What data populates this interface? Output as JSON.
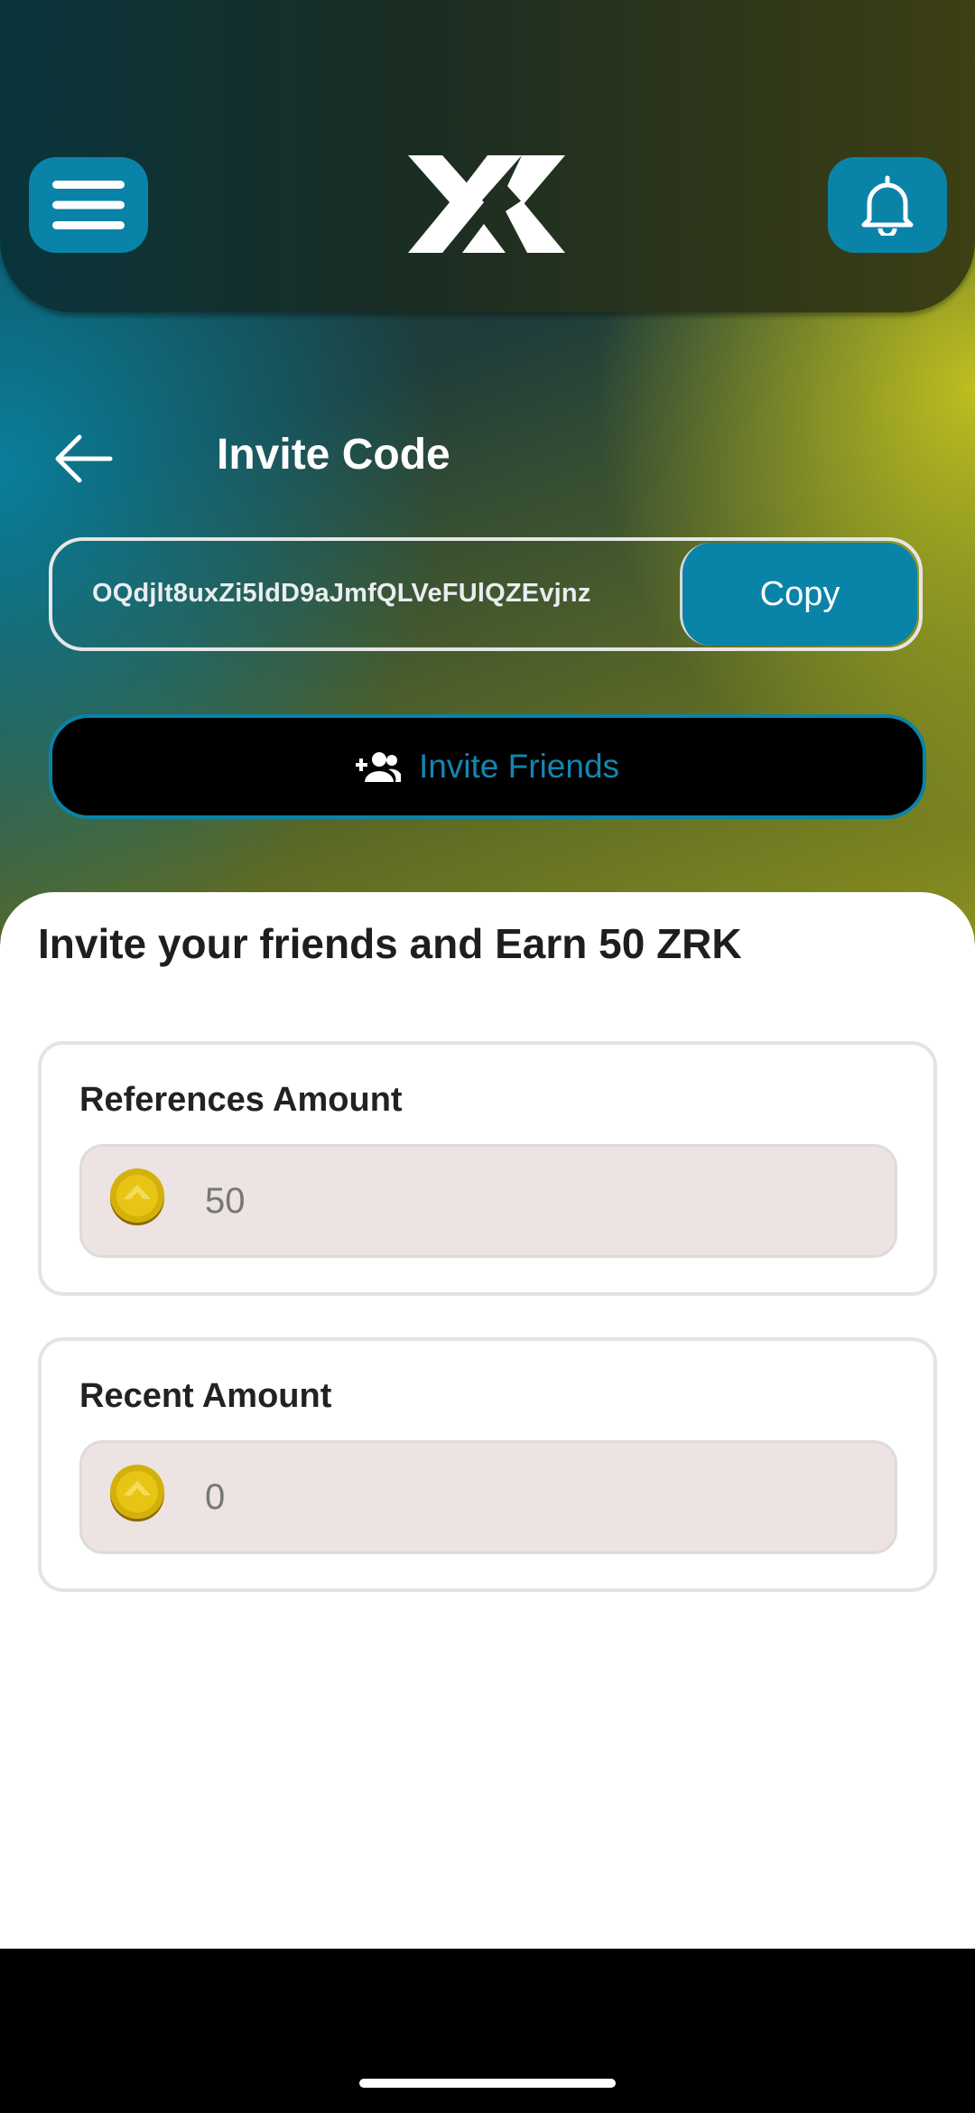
{
  "header": {
    "menu_icon": "hamburger-menu-icon",
    "logo_icon": "zk-logo",
    "bell_icon": "bell-icon"
  },
  "invite": {
    "title": "Invite Code",
    "back_icon": "arrow-left-icon",
    "code": "OQdjlt8uxZi5ldD9aJmfQLVeFUlQZEvjnz",
    "copy_label": "Copy",
    "invite_button_label": "Invite Friends",
    "invite_icon": "person-add-icon"
  },
  "rewards": {
    "headline": "Invite your friends and Earn 50 ZRK",
    "references": {
      "label": "References Amount",
      "value": "50",
      "icon": "coin-icon"
    },
    "recent": {
      "label": "Recent Amount",
      "value": "0",
      "icon": "coin-icon"
    }
  },
  "colors": {
    "accent": "#0a83a8",
    "field_bg": "#ede3e3"
  }
}
